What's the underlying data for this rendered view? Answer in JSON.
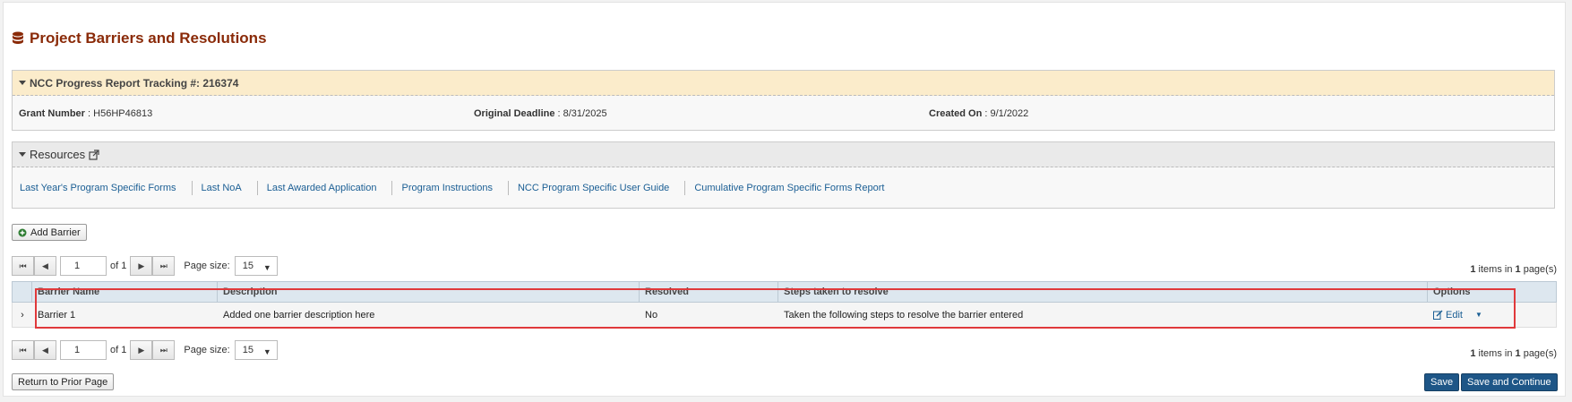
{
  "page": {
    "title": "Project Barriers and Resolutions",
    "icon": "database-icon",
    "title_color": "#8a2a08"
  },
  "tracking_panel": {
    "header": "NCC Progress Report Tracking #: 216374",
    "grant_label": "Grant Number",
    "grant_value": " : H56HP46813",
    "deadline_label": "Original Deadline",
    "deadline_value": " : 8/31/2025",
    "created_label": "Created On",
    "created_value": " : 9/1/2022"
  },
  "resources_panel": {
    "header": "Resources",
    "links": [
      "Last Year's Program Specific Forms",
      "Last NoA",
      "Last Awarded Application",
      "Program Instructions",
      "NCC Program Specific User Guide",
      "Cumulative Program Specific Forms Report"
    ]
  },
  "actions": {
    "add_barrier": "Add Barrier",
    "return_prior": "Return to Prior Page",
    "save": "Save",
    "save_continue": "Save and Continue"
  },
  "pager": {
    "page": "1",
    "of_label": "of 1",
    "page_size_label": "Page size:",
    "page_size": "15",
    "info_count": "1",
    "info_mid": " items in ",
    "info_pages": "1",
    "info_end": " page(s)"
  },
  "grid": {
    "columns": [
      "Barrier Name",
      "Description",
      "Resolved",
      "Steps taken to resolve",
      "Options"
    ],
    "rows": [
      {
        "name": "Barrier 1",
        "description": "Added one barrier description here",
        "resolved": "No",
        "steps": "Taken the following steps to resolve the barrier entered",
        "edit_label": "Edit"
      }
    ]
  },
  "colors": {
    "accent": "#1e5687",
    "link": "#1a5e94",
    "highlight_border": "#e0393b",
    "panel_header": "#fbeccb"
  }
}
